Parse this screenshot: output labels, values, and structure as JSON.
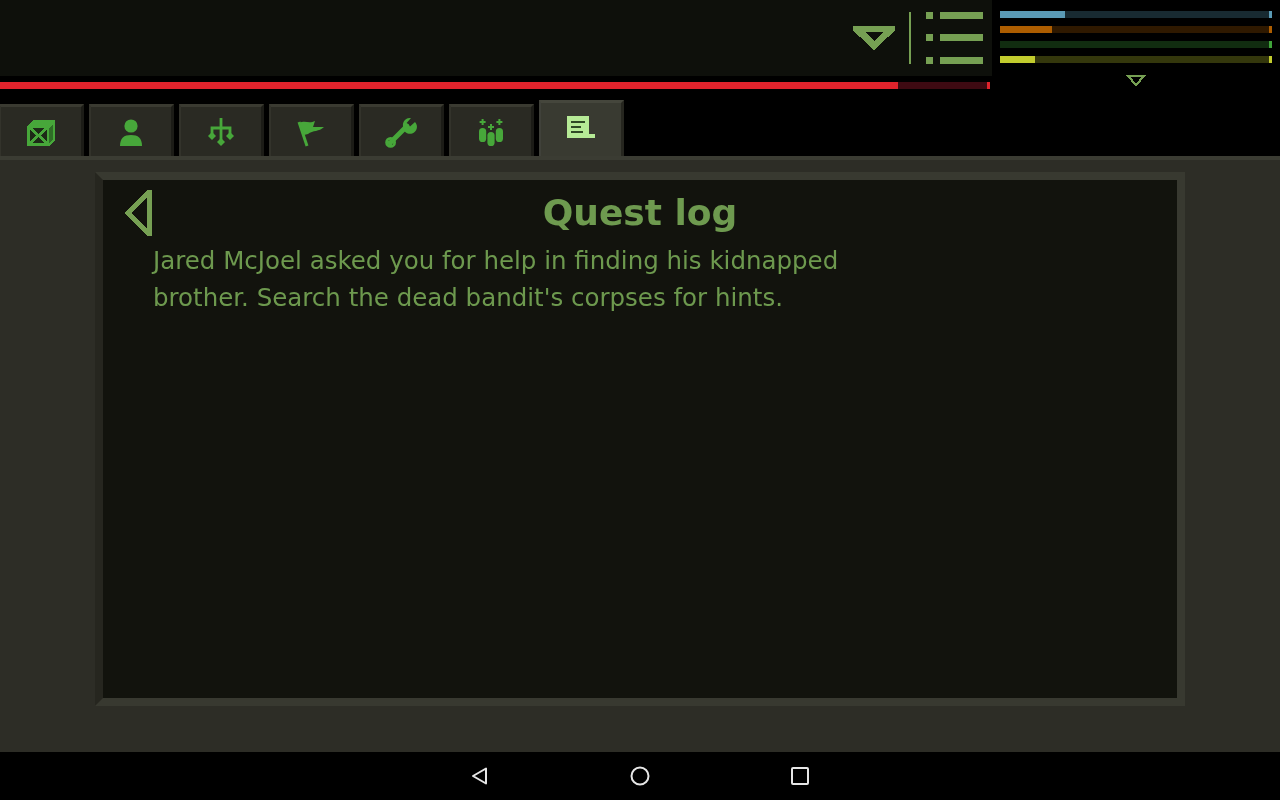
{
  "health_bar": {
    "level": 0.91
  },
  "stat_bars": [
    {
      "color": "#5a9ab5",
      "level": 0.24
    },
    {
      "color": "#ad5d00",
      "level": 0.19
    },
    {
      "color": "#3fa43a",
      "level": 0
    },
    {
      "color": "#c2cc2e",
      "level": 0.13
    }
  ],
  "tabs": [
    {
      "selected": false
    },
    {
      "selected": false
    },
    {
      "selected": false
    },
    {
      "selected": false
    },
    {
      "selected": false
    },
    {
      "selected": false
    },
    {
      "selected": true
    }
  ],
  "quest_log": {
    "title": "Quest log",
    "text": "Jared McJoel asked you for help in finding his kidnapped brother. Search the dead bandit's corpses for hints."
  }
}
